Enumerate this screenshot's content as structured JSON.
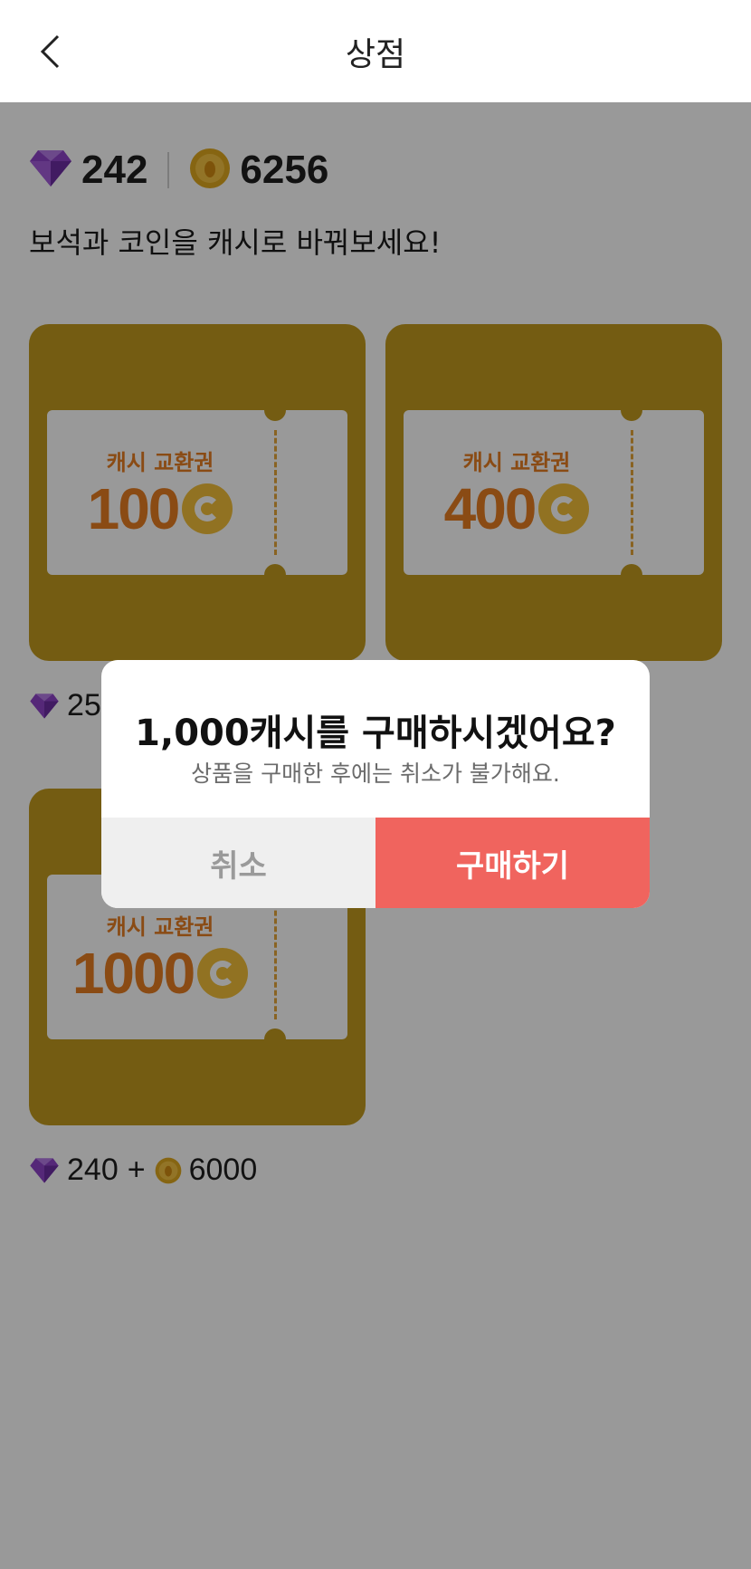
{
  "header": {
    "title": "상점",
    "back_icon": "chevron-left-icon"
  },
  "balance": {
    "gems": "242",
    "coins": "6256"
  },
  "subtitle": "보석과 코인을 캐시로 바꿔보세요!",
  "products": [
    {
      "ticket_label": "캐시 교환권",
      "amount": "100",
      "price_prefix": "25"
    },
    {
      "ticket_label": "캐시 교환권",
      "amount": "400"
    },
    {
      "ticket_label": "캐시 교환권",
      "amount": "1000",
      "price_gems": "240",
      "price_plus": "+",
      "price_coins": "6000"
    }
  ],
  "dialog": {
    "title": "1,000캐시를 구매하시겠어요?",
    "description": "상품을 구매한 후에는 취소가 불가해요.",
    "cancel_label": "취소",
    "confirm_label": "구매하기"
  },
  "colors": {
    "card": "#c19a1f",
    "ticket_text": "#e67e22",
    "confirm": "#f0645e",
    "gem": "#8e44c9",
    "coin": "#e0a81f"
  }
}
